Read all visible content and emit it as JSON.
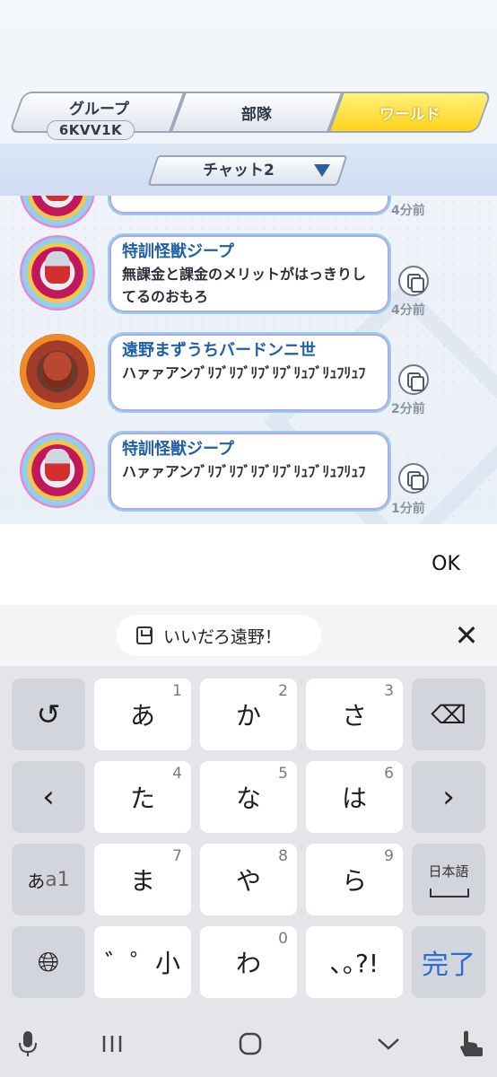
{
  "tabs": [
    {
      "label": "グループ",
      "sub": "6KVV1K"
    },
    {
      "label": "部隊"
    },
    {
      "label": "ワールド",
      "active": true
    }
  ],
  "chat_selector": {
    "label": "チャット2"
  },
  "messages": [
    {
      "time": "4分前"
    },
    {
      "name": "特訓怪獣ジープ",
      "text": "無課金と課金のメリットがはっきりしてるのおもろ",
      "time": "4分前"
    },
    {
      "name": "遠野まずうちバードンニ世",
      "text": "ハァァアンﾌﾞﾘﾌﾞﾘﾌﾞﾘﾌﾞﾘﾌﾞﾘｭﾌﾞﾘｭﾌﾘｭﾌ",
      "time": "2分前"
    },
    {
      "name": "特訓怪獣ジープ",
      "text": "ハァァアンﾌﾞﾘﾌﾞﾘﾌﾞﾘﾌﾞﾘﾌﾞﾘｭﾌﾞﾘｭﾌﾘｭﾌ",
      "time": "1分前"
    }
  ],
  "ok_label": "OK",
  "clipboard_suggestion": "いいだろ遠野！",
  "keyboard": {
    "keys": [
      {
        "label": "あ",
        "num": "1"
      },
      {
        "label": "か",
        "num": "2"
      },
      {
        "label": "さ",
        "num": "3"
      },
      {
        "label": "た",
        "num": "4"
      },
      {
        "label": "な",
        "num": "5"
      },
      {
        "label": "は",
        "num": "6"
      },
      {
        "label": "ま",
        "num": "7"
      },
      {
        "label": "や",
        "num": "8"
      },
      {
        "label": "ら",
        "num": "9"
      },
      {
        "label": "゛゜小"
      },
      {
        "label": "わ",
        "num": "0"
      },
      {
        "label": "､｡?!"
      }
    ],
    "mode_label_kana": "あ",
    "mode_label_alnum": "a1",
    "space_label": "日本語",
    "done_label": "完了"
  },
  "colors": {
    "active_tab": "#ffd21c",
    "name_blue": "#1f5fa8",
    "done_blue": "#2d6ad6"
  }
}
